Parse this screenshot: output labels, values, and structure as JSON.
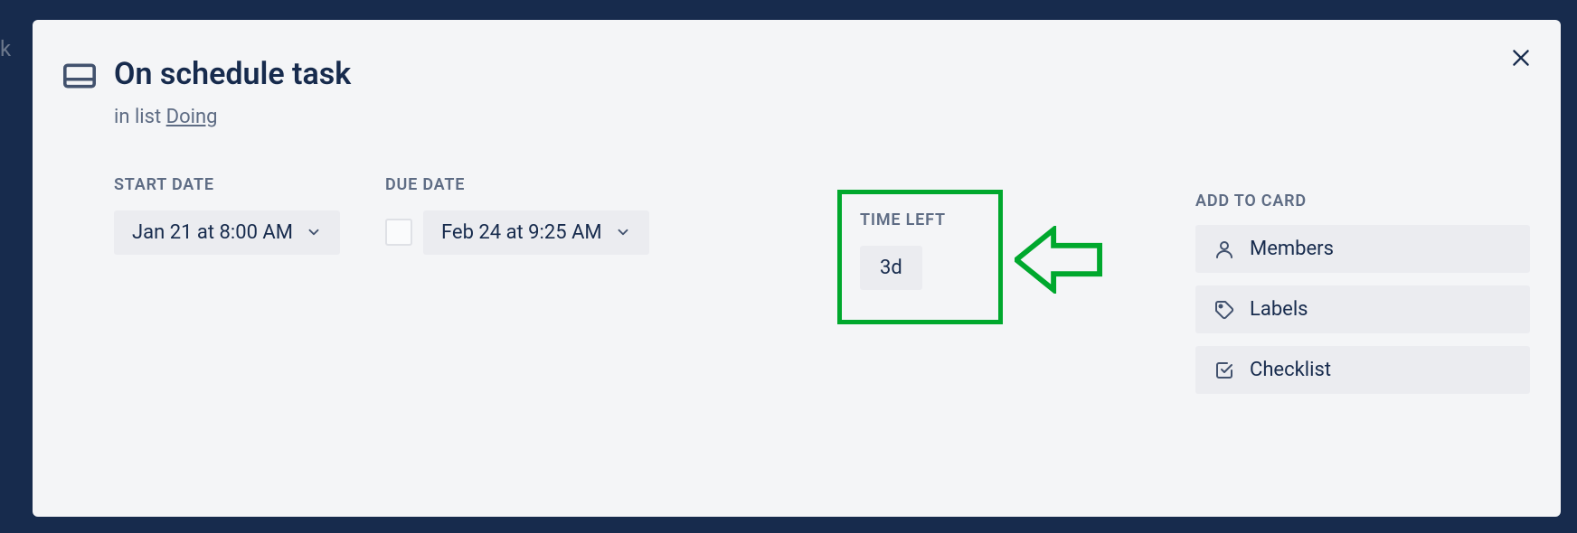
{
  "card": {
    "title": "On schedule task",
    "subtitle_prefix": "in list ",
    "list_name": "Doing"
  },
  "dates": {
    "start_label": "START DATE",
    "start_value": "Jan 21 at 8:00 AM",
    "due_label": "DUE DATE",
    "due_value": "Feb 24 at 9:25 AM",
    "time_left_label": "TIME LEFT",
    "time_left_value": "3d"
  },
  "sidebar": {
    "heading": "ADD TO CARD",
    "members": "Members",
    "labels": "Labels",
    "checklist": "Checklist"
  },
  "annotation": {
    "highlight_color": "#00a82d"
  }
}
